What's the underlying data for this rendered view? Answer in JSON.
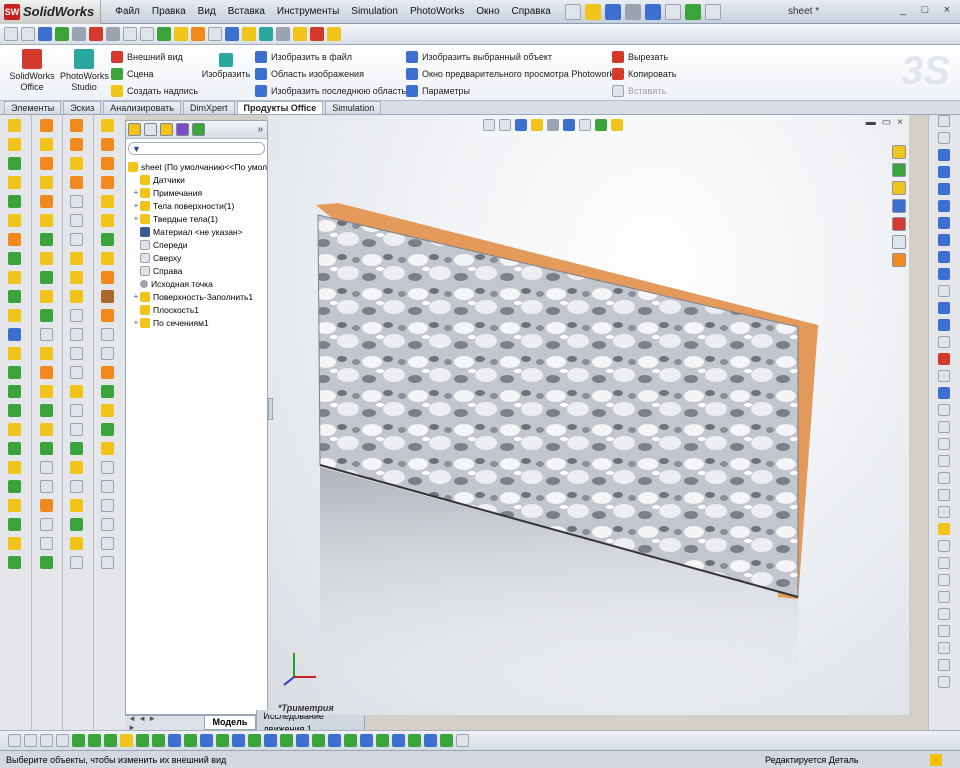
{
  "app": {
    "logo_text": "SolidWorks",
    "logo_mark": "SW",
    "document_title": "sheet *"
  },
  "menu": [
    "Файл",
    "Правка",
    "Вид",
    "Вставка",
    "Инструменты",
    "Simulation",
    "PhotoWorks",
    "Окно",
    "Справка"
  ],
  "window_buttons": [
    "_",
    "□",
    "×"
  ],
  "ribbon": {
    "large": [
      {
        "label": "SolidWorks Office",
        "icon": "solidworks-office-icon"
      },
      {
        "label": "PhotoWorks Studio",
        "icon": "photoworks-studio-icon"
      }
    ],
    "group1": [
      "Внешний вид",
      "Сцена",
      "Создать надпись"
    ],
    "render_label": "Изобразить",
    "group2": [
      "Изобразить в файл",
      "Область изображения",
      "Изобразить последнюю область"
    ],
    "group3": [
      "Изобразить выбранный объект",
      "Окно предварительного просмотра Photoworks",
      "Параметры"
    ],
    "group4": [
      "Вырезать",
      "Копировать",
      "Вставить"
    ]
  },
  "tabs": [
    "Элементы",
    "Эскиз",
    "Анализировать",
    "DimXpert",
    "Продукты Office",
    "Simulation"
  ],
  "active_tab": "Продукты Office",
  "feature_tree": {
    "root": "sheet  (По умолчанию<<По умол",
    "items": [
      {
        "label": "Датчики",
        "expandable": false,
        "icon_color": "#f0c419"
      },
      {
        "label": "Примечания",
        "expandable": true,
        "icon_color": "#f0c419"
      },
      {
        "label": "Тела поверхности(1)",
        "expandable": true,
        "icon_color": "#f0c419"
      },
      {
        "label": "Твердые тела(1)",
        "expandable": true,
        "icon_color": "#f0c419"
      },
      {
        "label": "Материал <не указан>",
        "expandable": false,
        "icon_color": "#3a5a9a"
      },
      {
        "label": "Спереди",
        "expandable": false,
        "icon_color": "#dfe4ea"
      },
      {
        "label": "Сверху",
        "expandable": false,
        "icon_color": "#dfe4ea"
      },
      {
        "label": "Справа",
        "expandable": false,
        "icon_color": "#dfe4ea"
      },
      {
        "label": "Исходная точка",
        "expandable": false,
        "icon_color": "#9aa3ae"
      },
      {
        "label": "Поверхность-Заполнить1",
        "expandable": true,
        "icon_color": "#f0c419"
      },
      {
        "label": "Плоскость1",
        "expandable": false,
        "icon_color": "#f0c419"
      },
      {
        "label": "По сечениям1",
        "expandable": true,
        "icon_color": "#f0c419"
      }
    ]
  },
  "bottom_tabs": {
    "model": "Модель",
    "motion": "Исследование движения 1"
  },
  "viewport": {
    "view_label": "*Триметрия",
    "panel_collapse": "»"
  },
  "status": {
    "left": "Выберите объекты, чтобы изменить их внешний вид",
    "right": "Редактируется Деталь"
  },
  "colors": {
    "part_edge": "#e49a5a",
    "surface": "#b9bcc2",
    "title_bar": "#c6cfdc"
  }
}
